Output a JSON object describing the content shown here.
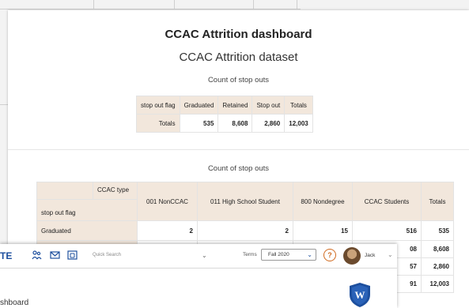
{
  "dashboard": {
    "title": "CCAC Attrition dashboard",
    "dataset": "CCAC Attrition dataset",
    "table1": {
      "caption": "Count of stop outs",
      "headers": [
        "stop out flag",
        "Graduated",
        "Retained",
        "Stop out",
        "Totals"
      ],
      "row_label": "Totals",
      "values": [
        "535",
        "8,608",
        "2,860",
        "12,003"
      ]
    },
    "table2": {
      "caption": "Count of stop outs",
      "col_group_label": "CCAC type",
      "row_header": "stop out flag",
      "headers": [
        "001 NonCCAC",
        "011 High School Student",
        "800 Nondegree",
        "CCAC Students",
        "Totals"
      ],
      "rows": [
        {
          "label": "Graduated",
          "values": [
            "2",
            "2",
            "15",
            "516",
            "535"
          ]
        },
        {
          "label": "",
          "values": [
            "",
            "",
            "",
            "08",
            "8,608"
          ]
        },
        {
          "label": "",
          "values": [
            "",
            "",
            "",
            "57",
            "2,860"
          ]
        },
        {
          "label": "",
          "values": [
            "",
            "",
            "",
            "91",
            "12,003"
          ]
        }
      ]
    }
  },
  "app": {
    "brand": "TE",
    "search_placeholder": "Quick Search",
    "terms_label": "Terms",
    "terms_value": "Fall 2020",
    "help": "?",
    "user": "Jack",
    "breadcrumb": "shboard",
    "shield_letter": "W",
    "colors": {
      "brand": "#1d4f9e",
      "help": "#d06a1f",
      "header_fill": "#f2e7dc"
    }
  }
}
